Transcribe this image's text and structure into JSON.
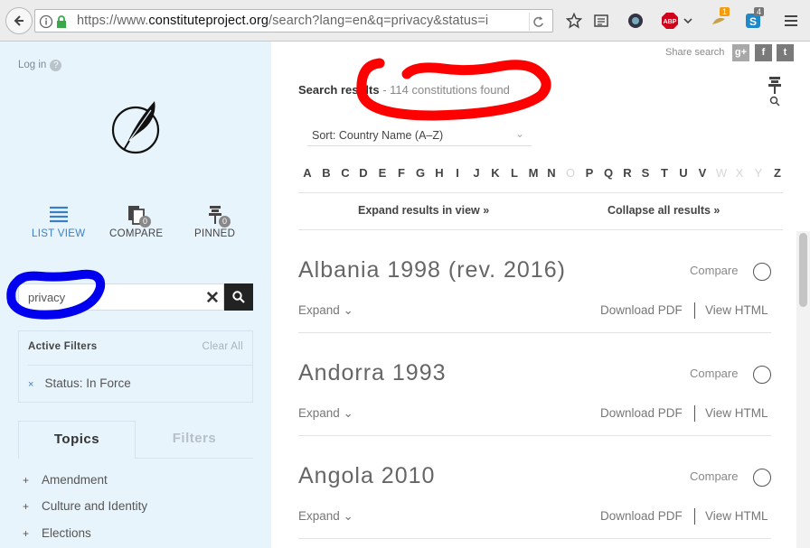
{
  "browser": {
    "url_prefix": "https://www.",
    "url_domain": "constituteproject.org",
    "url_path": "/search?lang=en&q=privacy&status=i",
    "badge_orange": "1",
    "badge_gray": "4"
  },
  "sidebar": {
    "login": "Log in",
    "help": "?",
    "views": [
      {
        "label": "LIST VIEW"
      },
      {
        "label": "COMPARE",
        "count": "0"
      },
      {
        "label": "PINNED",
        "count": "0"
      }
    ],
    "search_value": "privacy",
    "active_filters_title": "Active Filters",
    "clear_all": "Clear All",
    "filter_x": "×",
    "filter_item": "Status: In Force",
    "tab_topics": "Topics",
    "tab_filters": "Filters",
    "topics": [
      "Amendment",
      "Culture and Identity",
      "Elections"
    ],
    "plus": "+"
  },
  "main": {
    "share_label": "Share search",
    "social": [
      "g+",
      "f",
      "t"
    ],
    "results_prefix": "Search results",
    "results_count": " - 114 constitutions found",
    "sort_label": "Sort:  Country Name (A–Z)",
    "sort_chevron": "⌄",
    "alphabet": [
      {
        "l": "A",
        "on": true
      },
      {
        "l": "B",
        "on": true
      },
      {
        "l": "C",
        "on": true
      },
      {
        "l": "D",
        "on": true
      },
      {
        "l": "E",
        "on": true
      },
      {
        "l": "F",
        "on": true
      },
      {
        "l": "G",
        "on": true
      },
      {
        "l": "H",
        "on": true
      },
      {
        "l": "I",
        "on": true
      },
      {
        "l": "J",
        "on": true
      },
      {
        "l": "K",
        "on": true
      },
      {
        "l": "L",
        "on": true
      },
      {
        "l": "M",
        "on": true
      },
      {
        "l": "N",
        "on": true
      },
      {
        "l": "O",
        "on": false
      },
      {
        "l": "P",
        "on": true
      },
      {
        "l": "Q",
        "on": true
      },
      {
        "l": "R",
        "on": true
      },
      {
        "l": "S",
        "on": true
      },
      {
        "l": "T",
        "on": true
      },
      {
        "l": "U",
        "on": true
      },
      {
        "l": "V",
        "on": true
      },
      {
        "l": "W",
        "on": false
      },
      {
        "l": "X",
        "on": false
      },
      {
        "l": "Y",
        "on": false
      },
      {
        "l": "Z",
        "on": true
      }
    ],
    "expand_all": "Expand results in view »",
    "collapse_all": "Collapse all results »",
    "results": [
      {
        "title": "Albania 1998 (rev. 2016)",
        "compare": "Compare",
        "expand": "Expand ⌄",
        "pdf": "Download PDF",
        "html": "View HTML"
      },
      {
        "title": "Andorra 1993",
        "compare": "Compare",
        "expand": "Expand ⌄",
        "pdf": "Download PDF",
        "html": "View HTML"
      },
      {
        "title": "Angola 2010",
        "compare": "Compare",
        "expand": "Expand ⌄",
        "pdf": "Download PDF",
        "html": "View HTML"
      }
    ]
  },
  "colors": {
    "sidebar_bg": "#e8f4fc",
    "accent_blue": "#3a7fc6",
    "annotation_red": "#ff0000",
    "annotation_blue": "#0000ee"
  }
}
